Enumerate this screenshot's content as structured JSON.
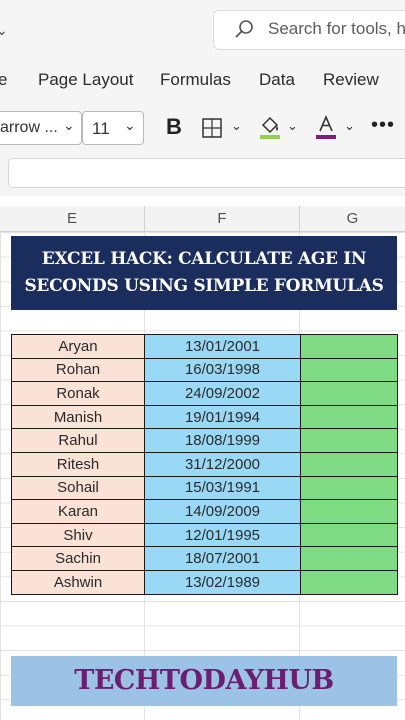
{
  "search": {
    "placeholder": "Search for tools, h"
  },
  "menu_tabs": [
    "e",
    "Page Layout",
    "Formulas",
    "Data",
    "Review"
  ],
  "toolbar": {
    "font_name": "arrow ...",
    "font_size": "11",
    "bold_label": "B",
    "more_label": "•••",
    "fill_color": "#92d050",
    "font_color": "#7a1f7a"
  },
  "columns": [
    "E",
    "F",
    "G"
  ],
  "banner": {
    "line1": "EXCEL HACK: CALCULATE AGE IN",
    "line2": "SECONDS USING SIMPLE FORMULAS"
  },
  "table": {
    "rows": [
      {
        "name": "Aryan",
        "dob": "13/01/2001"
      },
      {
        "name": "Rohan",
        "dob": "16/03/1998"
      },
      {
        "name": "Ronak",
        "dob": "24/09/2002"
      },
      {
        "name": "Manish",
        "dob": "19/01/1994"
      },
      {
        "name": "Rahul",
        "dob": "18/08/1999"
      },
      {
        "name": "Ritesh",
        "dob": "31/12/2000"
      },
      {
        "name": "Sohail",
        "dob": "15/03/1991"
      },
      {
        "name": "Karan",
        "dob": "14/09/2009"
      },
      {
        "name": "Shiv",
        "dob": "12/01/1995"
      },
      {
        "name": "Sachin",
        "dob": "18/07/2001"
      },
      {
        "name": "Ashwin",
        "dob": "13/02/1989"
      }
    ]
  },
  "footer": {
    "brand": "TECHTODAYHUB"
  },
  "colors": {
    "banner_bg": "#1a2d5c",
    "name_fill": "#fbe2d6",
    "date_fill": "#9ad9f6",
    "result_fill": "#7fdc84",
    "footer_bg": "#9cc3e6",
    "footer_text": "#6b1d6f"
  }
}
